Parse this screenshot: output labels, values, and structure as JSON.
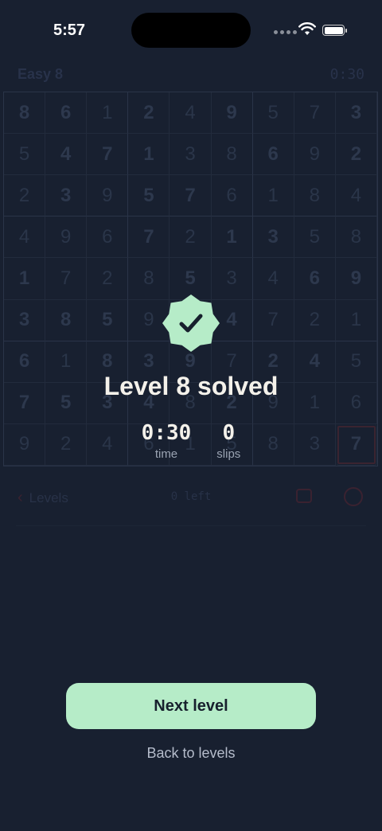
{
  "status_bar": {
    "time": "5:57"
  },
  "game": {
    "title": "Easy 8",
    "timer": "0:30",
    "grid": [
      [
        "8",
        "6",
        "1",
        "2",
        "4",
        "9",
        "5",
        "7",
        "3"
      ],
      [
        "5",
        "4",
        "7",
        "1",
        "3",
        "8",
        "6",
        "9",
        "2"
      ],
      [
        "2",
        "3",
        "9",
        "5",
        "7",
        "6",
        "1",
        "8",
        "4"
      ],
      [
        "4",
        "9",
        "6",
        "7",
        "2",
        "1",
        "3",
        "5",
        "8"
      ],
      [
        "1",
        "7",
        "2",
        "8",
        "5",
        "3",
        "4",
        "6",
        "9"
      ],
      [
        "3",
        "8",
        "5",
        "9",
        "6",
        "4",
        "7",
        "2",
        "1"
      ],
      [
        "6",
        "1",
        "8",
        "3",
        "9",
        "7",
        "2",
        "4",
        "5"
      ],
      [
        "7",
        "5",
        "3",
        "4",
        "8",
        "2",
        "9",
        "1",
        "6"
      ],
      [
        "9",
        "2",
        "4",
        "6",
        "1",
        "5",
        "8",
        "3",
        "7"
      ]
    ],
    "given": [
      [
        1,
        1,
        0,
        1,
        0,
        1,
        0,
        0,
        1
      ],
      [
        0,
        1,
        1,
        1,
        0,
        0,
        1,
        0,
        1
      ],
      [
        0,
        1,
        0,
        1,
        1,
        0,
        0,
        0,
        0
      ],
      [
        0,
        0,
        0,
        1,
        0,
        1,
        1,
        0,
        0
      ],
      [
        1,
        0,
        0,
        0,
        1,
        0,
        0,
        1,
        1
      ],
      [
        1,
        1,
        1,
        0,
        0,
        1,
        0,
        0,
        0
      ],
      [
        1,
        0,
        1,
        1,
        1,
        0,
        1,
        1,
        0
      ],
      [
        1,
        1,
        1,
        1,
        0,
        1,
        0,
        0,
        0
      ],
      [
        0,
        0,
        0,
        0,
        0,
        0,
        0,
        0,
        1
      ]
    ],
    "selected_cell": [
      8,
      8
    ],
    "back_label": "Levels",
    "remaining": "0 left"
  },
  "overlay": {
    "title": "Level 8 solved",
    "stats": [
      {
        "value": "0:30",
        "label": "time"
      },
      {
        "value": "0",
        "label": "slips"
      }
    ],
    "next_button": "Next level",
    "back_link": "Back to levels"
  },
  "colors": {
    "background": "#182030",
    "accent": "#b6ecc8",
    "title_text": "#f4f1ea",
    "muted_text": "#9aa3b2"
  },
  "icons": {
    "badge": "verified-check-badge-icon",
    "back": "chevron-left-icon",
    "hint": "speech-bubble-icon",
    "theme": "palette-icon"
  }
}
